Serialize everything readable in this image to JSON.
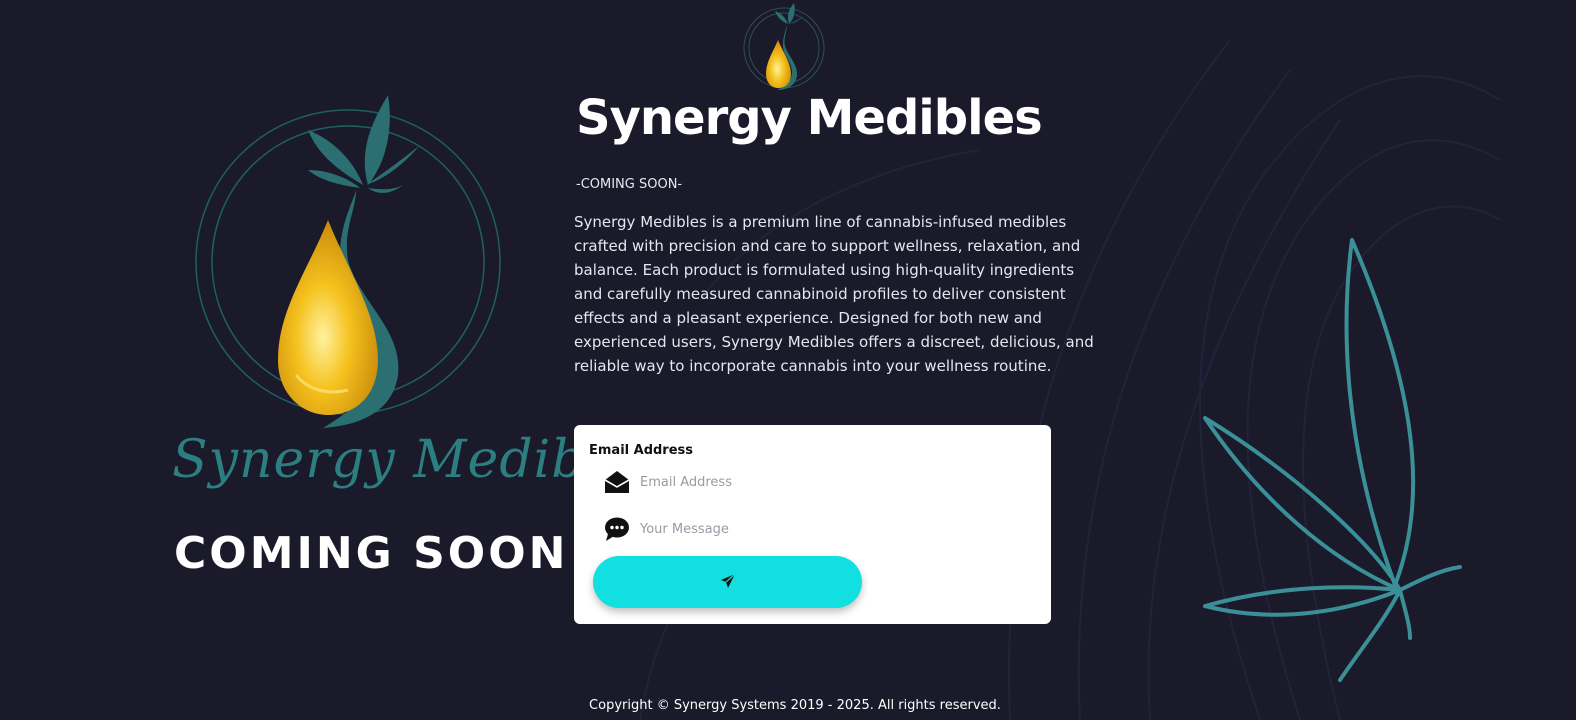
{
  "brand": {
    "script_name": "Synergy Medibles",
    "coming_soon": "COMING SOON"
  },
  "header": {
    "title": "Synergy Medibles",
    "subtitle": "-COMING SOON-"
  },
  "main": {
    "description": "Synergy Medibles is a premium line of cannabis-infused medibles crafted with precision and care to support wellness, relaxation, and balance. Each product is formulated using high-quality ingredients and carefully measured cannabinoid profiles to deliver consistent effects and a pleasant experience. Designed for both new and experienced users, Synergy Medibles offers a discreet, delicious, and reliable way to incorporate cannabis into your wellness routine."
  },
  "form": {
    "email_label": "Email Address",
    "email_placeholder": "Email Address",
    "email_value": "",
    "message_placeholder": "Your Message",
    "message_value": "",
    "email_icon": "envelope-open-icon",
    "message_icon": "speech-bubble-icon",
    "send_icon": "paper-plane-icon"
  },
  "footer": {
    "copyright": "Copyright © Synergy Systems 2019 - 2025. All rights reserved."
  },
  "colors": {
    "background": "#1a1a2b",
    "accent": "#12dfdf",
    "teal": "#2c7f80",
    "leaf_outline": "#3b8f96",
    "gold": "#f0b820"
  }
}
